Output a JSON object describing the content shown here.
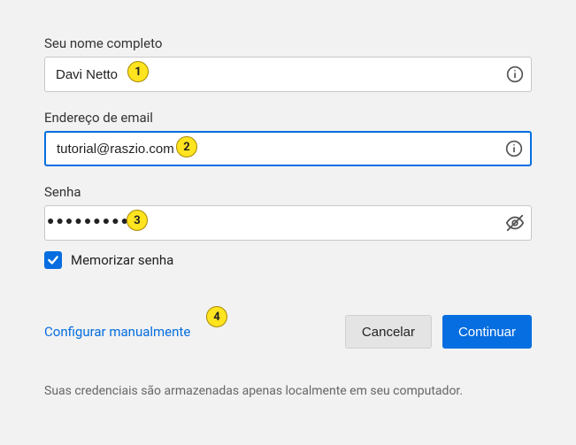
{
  "fields": {
    "fullname": {
      "label": "Seu nome completo",
      "value": "Davi Netto"
    },
    "email": {
      "label": "Endereço de email",
      "value": "tutorial@raszio.com"
    },
    "password": {
      "label": "Senha",
      "masked_value": "●●●●●●●●●●●"
    }
  },
  "remember": {
    "label": "Memorizar senha",
    "checked": true
  },
  "actions": {
    "manual_link": "Configurar manualmente",
    "cancel": "Cancelar",
    "continue": "Continuar"
  },
  "note": "Suas credenciais são armazenadas apenas localmente em seu computador.",
  "annotations": {
    "a1": "1",
    "a2": "2",
    "a3": "3",
    "a4": "4"
  }
}
